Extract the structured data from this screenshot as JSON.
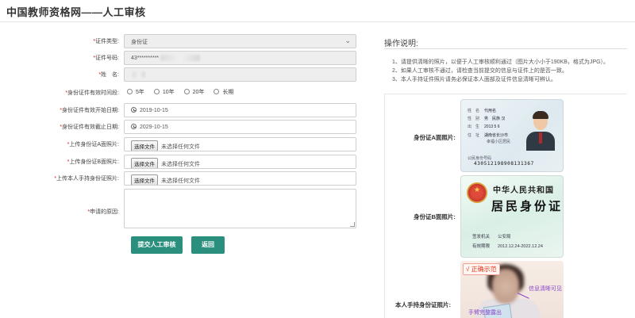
{
  "page": {
    "title": "中国教师资格网——人工审核"
  },
  "form": {
    "id_type": {
      "label": "证件类型:",
      "value": "身份证"
    },
    "id_number": {
      "label": "证件号码:",
      "value": "43**********"
    },
    "name": {
      "label": "姓　名:",
      "value": ""
    },
    "validity_period": {
      "label": "身份证件有效时间段:",
      "options": [
        "5年",
        "10年",
        "20年",
        "长期"
      ]
    },
    "start_date": {
      "label": "身份证件有效开始日期:",
      "value": "2019-10-15"
    },
    "end_date": {
      "label": "身份证件有效截止日期:",
      "value": "2029-10-15"
    },
    "upload_front": {
      "label": "上传身份证A面照片:",
      "button": "选择文件",
      "status": "未选择任何文件"
    },
    "upload_back": {
      "label": "上传身份证B面照片:",
      "button": "选择文件",
      "status": "未选择任何文件"
    },
    "upload_hand": {
      "label": "上传本人手持身份证照片:",
      "button": "选择文件",
      "status": "未选择任何文件"
    },
    "reason": {
      "label": "申请的原因:",
      "value": ""
    },
    "submit_label": "提交人工审核",
    "back_label": "返回"
  },
  "instructions": {
    "title": "操作说明:",
    "items": [
      "1、请提供清晰的照片，以便于人工审核顺利通过（图片大小小于190KB，格式为JPG）。",
      "2、如果人工审核不通过，请检查当前提交的信息与证件上的是否一致。",
      "3、本人手持证件照片请务必保证本人面部及证件信息清晰可辨认。"
    ]
  },
  "samples": {
    "front_label": "身份证A面照片:",
    "back_label": "身份证B面照片:",
    "hand_label": "本人手持身份证照片:",
    "front_card": {
      "name_key": "姓　名",
      "name_val": "代用名",
      "gender_key": "性　别",
      "gender_val": "男　民族 汉",
      "birth_key": "出　生",
      "birth_val": "2013 5 6",
      "addr_key": "住　址",
      "addr_val": "湖南省长沙市",
      "addr2_val": "幸福小区居民",
      "id_key": "公民身份号码",
      "id_number": "430512198908131367"
    },
    "back_card": {
      "country": "中华人民共和国",
      "title": "居民身份证",
      "issuer_key": "签发机关",
      "issuer_val": "公安局",
      "valid_key": "有效期限",
      "valid_val": "2012.12.24-2022.12.24"
    },
    "hand_photo": {
      "tag": "√ 正确示范",
      "note_clear": "信息清晰可见",
      "note_hand": "手臂完整露出"
    }
  },
  "colors": {
    "button": "#2b8f7e",
    "required": "#e02020",
    "demo_tag": "#e0391f",
    "annotation": "#8b48c9"
  }
}
